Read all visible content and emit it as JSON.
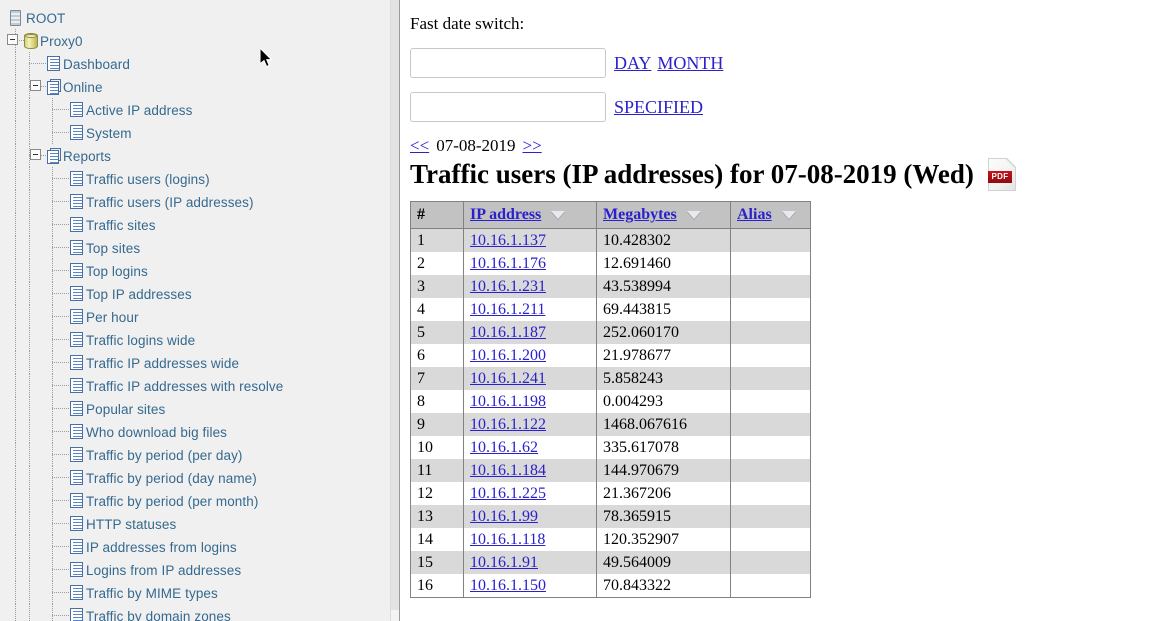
{
  "sidebar": {
    "tree": [
      {
        "label": "ROOT",
        "depth": 0,
        "icon": "server-stack-icon",
        "expander": false
      },
      {
        "label": "Proxy0",
        "depth": 1,
        "icon": "database-icon",
        "expander": true
      },
      {
        "label": "Dashboard",
        "depth": 2,
        "icon": "document-icon",
        "expander": false
      },
      {
        "label": "Online",
        "depth": 2,
        "icon": "document-group-icon",
        "expander": true
      },
      {
        "label": "Active IP address",
        "depth": 3,
        "icon": "document-icon",
        "expander": false
      },
      {
        "label": "System",
        "depth": 3,
        "icon": "document-icon",
        "expander": false
      },
      {
        "label": "Reports",
        "depth": 2,
        "icon": "document-group-icon",
        "expander": true
      },
      {
        "label": "Traffic users (logins)",
        "depth": 3,
        "icon": "document-icon",
        "expander": false
      },
      {
        "label": "Traffic users (IP addresses)",
        "depth": 3,
        "icon": "document-icon",
        "expander": false
      },
      {
        "label": "Traffic sites",
        "depth": 3,
        "icon": "document-icon",
        "expander": false
      },
      {
        "label": "Top sites",
        "depth": 3,
        "icon": "document-icon",
        "expander": false
      },
      {
        "label": "Top logins",
        "depth": 3,
        "icon": "document-icon",
        "expander": false
      },
      {
        "label": "Top IP addresses",
        "depth": 3,
        "icon": "document-icon",
        "expander": false
      },
      {
        "label": "Per hour",
        "depth": 3,
        "icon": "document-icon",
        "expander": false
      },
      {
        "label": "Traffic logins wide",
        "depth": 3,
        "icon": "document-icon",
        "expander": false
      },
      {
        "label": "Traffic IP addresses wide",
        "depth": 3,
        "icon": "document-icon",
        "expander": false
      },
      {
        "label": "Traffic IP addresses with resolve",
        "depth": 3,
        "icon": "document-icon",
        "expander": false
      },
      {
        "label": "Popular sites",
        "depth": 3,
        "icon": "document-icon",
        "expander": false
      },
      {
        "label": "Who download big files",
        "depth": 3,
        "icon": "document-icon",
        "expander": false
      },
      {
        "label": "Traffic by period (per day)",
        "depth": 3,
        "icon": "document-icon",
        "expander": false
      },
      {
        "label": "Traffic by period (day name)",
        "depth": 3,
        "icon": "document-icon",
        "expander": false
      },
      {
        "label": "Traffic by period (per month)",
        "depth": 3,
        "icon": "document-icon",
        "expander": false
      },
      {
        "label": "HTTP statuses",
        "depth": 3,
        "icon": "document-icon",
        "expander": false
      },
      {
        "label": "IP addresses from logins",
        "depth": 3,
        "icon": "document-icon",
        "expander": false
      },
      {
        "label": "Logins from IP addresses",
        "depth": 3,
        "icon": "document-icon",
        "expander": false
      },
      {
        "label": "Traffic by MIME types",
        "depth": 3,
        "icon": "document-icon",
        "expander": false
      },
      {
        "label": "Traffic by domain zones",
        "depth": 3,
        "icon": "document-icon",
        "expander": false
      }
    ]
  },
  "main": {
    "fast_date_switch_label": "Fast date switch:",
    "date_input_1": {
      "value": "",
      "placeholder": ""
    },
    "date_input_2": {
      "value": "",
      "placeholder": ""
    },
    "day_link": "DAY",
    "month_link": "MONTH",
    "specified_link": "SPECIFIED",
    "nav": {
      "prev": "<<",
      "date": "07-08-2019",
      "next": ">>"
    },
    "page_title": "Traffic users (IP addresses) for 07-08-2019 (Wed)",
    "pdf_badge": "PDF",
    "table": {
      "headers": [
        "#",
        "IP address",
        "Megabytes",
        "Alias"
      ],
      "rows": [
        {
          "n": "1",
          "ip": "10.16.1.137",
          "mb": "10.428302",
          "alias": ""
        },
        {
          "n": "2",
          "ip": "10.16.1.176",
          "mb": "12.691460",
          "alias": ""
        },
        {
          "n": "3",
          "ip": "10.16.1.231",
          "mb": "43.538994",
          "alias": ""
        },
        {
          "n": "4",
          "ip": "10.16.1.211",
          "mb": "69.443815",
          "alias": ""
        },
        {
          "n": "5",
          "ip": "10.16.1.187",
          "mb": "252.060170",
          "alias": ""
        },
        {
          "n": "6",
          "ip": "10.16.1.200",
          "mb": "21.978677",
          "alias": ""
        },
        {
          "n": "7",
          "ip": "10.16.1.241",
          "mb": "5.858243",
          "alias": ""
        },
        {
          "n": "8",
          "ip": "10.16.1.198",
          "mb": "0.004293",
          "alias": ""
        },
        {
          "n": "9",
          "ip": "10.16.1.122",
          "mb": "1468.067616",
          "alias": ""
        },
        {
          "n": "10",
          "ip": "10.16.1.62",
          "mb": "335.617078",
          "alias": ""
        },
        {
          "n": "11",
          "ip": "10.16.1.184",
          "mb": "144.970679",
          "alias": ""
        },
        {
          "n": "12",
          "ip": "10.16.1.225",
          "mb": "21.367206",
          "alias": ""
        },
        {
          "n": "13",
          "ip": "10.16.1.99",
          "mb": "78.365915",
          "alias": ""
        },
        {
          "n": "14",
          "ip": "10.16.1.118",
          "mb": "120.352907",
          "alias": ""
        },
        {
          "n": "15",
          "ip": "10.16.1.91",
          "mb": "49.564009",
          "alias": ""
        },
        {
          "n": "16",
          "ip": "10.16.1.150",
          "mb": "70.843322",
          "alias": ""
        }
      ]
    }
  },
  "colors": {
    "link": "#2a20cc",
    "tree_text": "#35698f",
    "sidebar_bg": "#f0f0f0",
    "table_header_bg": "#c2c2c2",
    "row_odd_bg": "#d9d9d9",
    "pdf_red": "#b5141a"
  }
}
